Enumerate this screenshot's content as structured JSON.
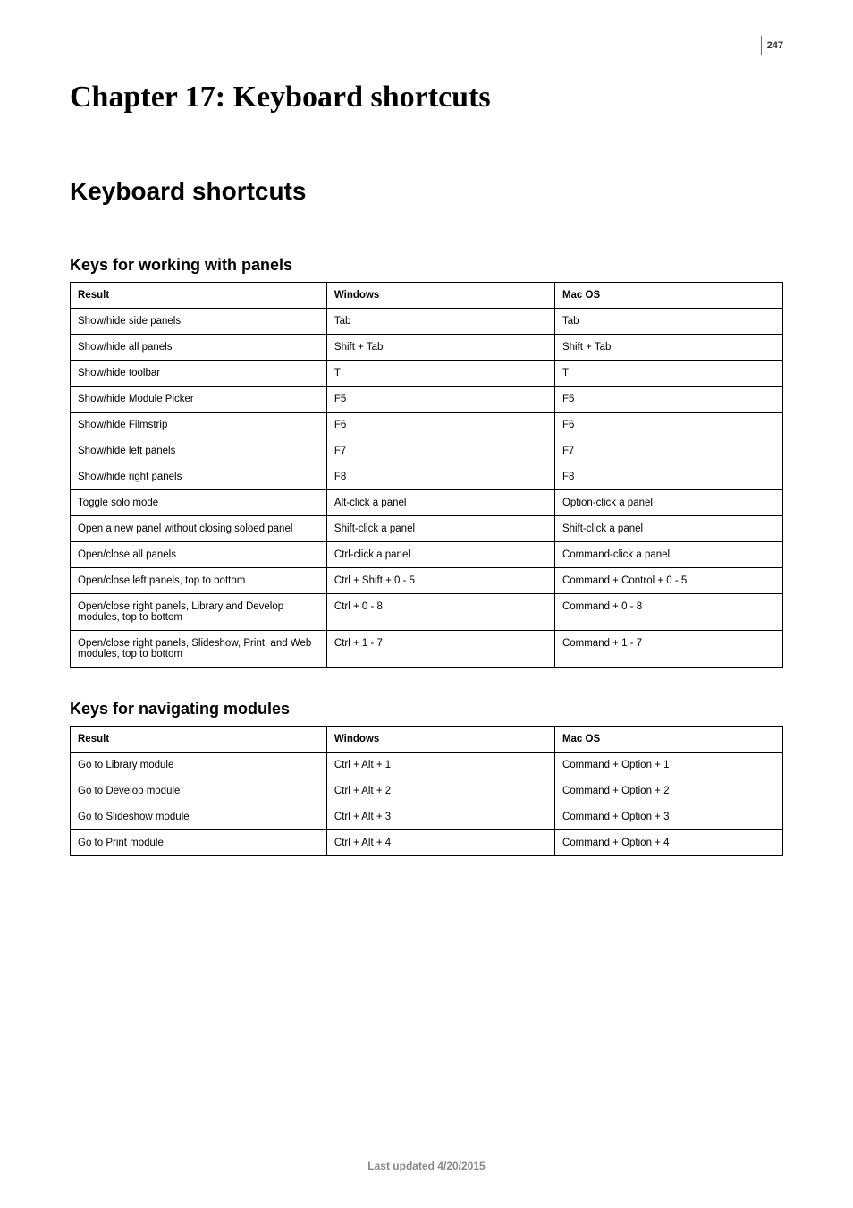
{
  "pageNumber": "247",
  "chapterTitle": "Chapter 17: Keyboard shortcuts",
  "sectionTitle": "Keyboard shortcuts",
  "panelsSection": {
    "title": "Keys for working with panels",
    "headers": {
      "result": "Result",
      "windows": "Windows",
      "mac": "Mac OS"
    },
    "rows": [
      {
        "result": "Show/hide side panels",
        "win": "Tab",
        "mac": "Tab"
      },
      {
        "result": "Show/hide all panels",
        "win": "Shift + Tab",
        "mac": "Shift + Tab"
      },
      {
        "result": "Show/hide toolbar",
        "win": "T",
        "mac": "T"
      },
      {
        "result": "Show/hide Module Picker",
        "win": "F5",
        "mac": "F5"
      },
      {
        "result": "Show/hide Filmstrip",
        "win": "F6",
        "mac": "F6"
      },
      {
        "result": "Show/hide left panels",
        "win": "F7",
        "mac": "F7"
      },
      {
        "result": "Show/hide right panels",
        "win": "F8",
        "mac": "F8"
      },
      {
        "result": "Toggle solo mode",
        "win": "Alt-click a panel",
        "mac": "Option-click a panel"
      },
      {
        "result": "Open a new panel without closing soloed panel",
        "win": "Shift-click a panel",
        "mac": "Shift-click a panel"
      },
      {
        "result": "Open/close all panels",
        "win": "Ctrl-click a panel",
        "mac": "Command-click a panel"
      },
      {
        "result": "Open/close left panels, top to bottom",
        "win": "Ctrl + Shift + 0 - 5",
        "mac": "Command + Control + 0 - 5"
      },
      {
        "result": "Open/close right panels, Library and Develop modules, top to bottom",
        "win": "Ctrl + 0 - 8",
        "mac": "Command + 0 - 8"
      },
      {
        "result": "Open/close right panels, Slideshow, Print, and Web modules, top to bottom",
        "win": "Ctrl + 1 - 7",
        "mac": "Command + 1 - 7"
      }
    ]
  },
  "modulesSection": {
    "title": "Keys for navigating modules",
    "headers": {
      "result": "Result",
      "windows": "Windows",
      "mac": "Mac OS"
    },
    "rows": [
      {
        "result": "Go to Library module",
        "win": "Ctrl + Alt + 1",
        "mac": "Command + Option + 1"
      },
      {
        "result": "Go to Develop module",
        "win": "Ctrl + Alt + 2",
        "mac": "Command + Option + 2"
      },
      {
        "result": "Go to Slideshow module",
        "win": "Ctrl + Alt + 3",
        "mac": "Command + Option + 3"
      },
      {
        "result": "Go to Print module",
        "win": "Ctrl + Alt + 4",
        "mac": "Command + Option + 4"
      }
    ]
  },
  "footer": "Last updated 4/20/2015"
}
